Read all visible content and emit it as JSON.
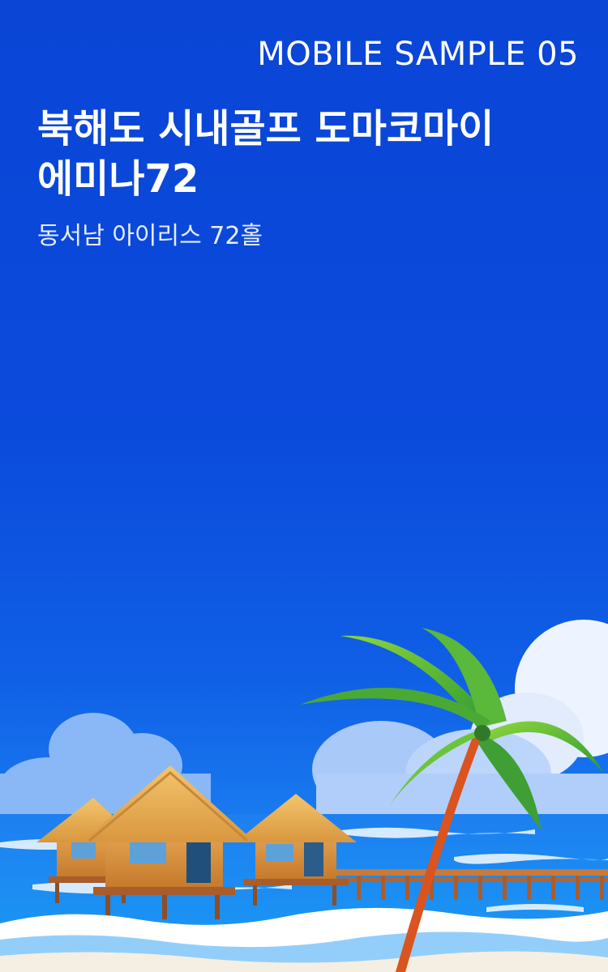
{
  "header": {
    "sample_label": "MOBILE SAMPLE 05"
  },
  "hero": {
    "title_line1": "북해도 시내골프 도마코마이",
    "title_line2": "에미나72",
    "subtitle": "동서남 아이리스 72홀"
  },
  "colors": {
    "background": "#0b4bdc",
    "text": "#ffffff"
  }
}
